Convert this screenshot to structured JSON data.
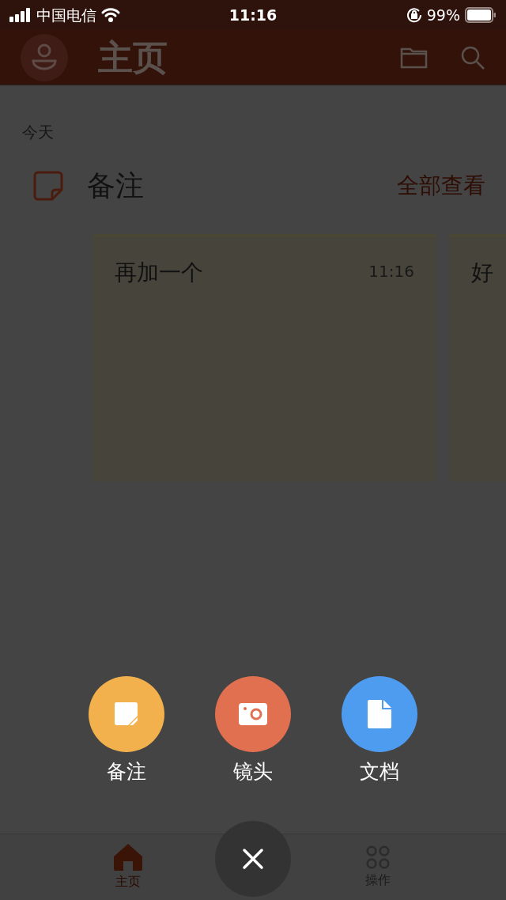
{
  "status_bar": {
    "carrier": "中国电信",
    "time": "11:16",
    "battery": "99%"
  },
  "header": {
    "title": "主页"
  },
  "section_date": "今天",
  "notes_section": {
    "title": "备注",
    "view_all": "全部查看"
  },
  "notes": [
    {
      "title": "再加一个",
      "time": "11:16"
    },
    {
      "title": "好"
    }
  ],
  "actions": [
    {
      "kind": "note",
      "label": "备注",
      "color": "#f2b14c"
    },
    {
      "kind": "camera",
      "label": "镜头",
      "color": "#e07050"
    },
    {
      "kind": "document",
      "label": "文档",
      "color": "#4e9cf0"
    }
  ],
  "tabs": [
    {
      "kind": "home",
      "label": "主页",
      "selected": true
    },
    {
      "kind": "grid",
      "label": "操作",
      "selected": false
    }
  ]
}
